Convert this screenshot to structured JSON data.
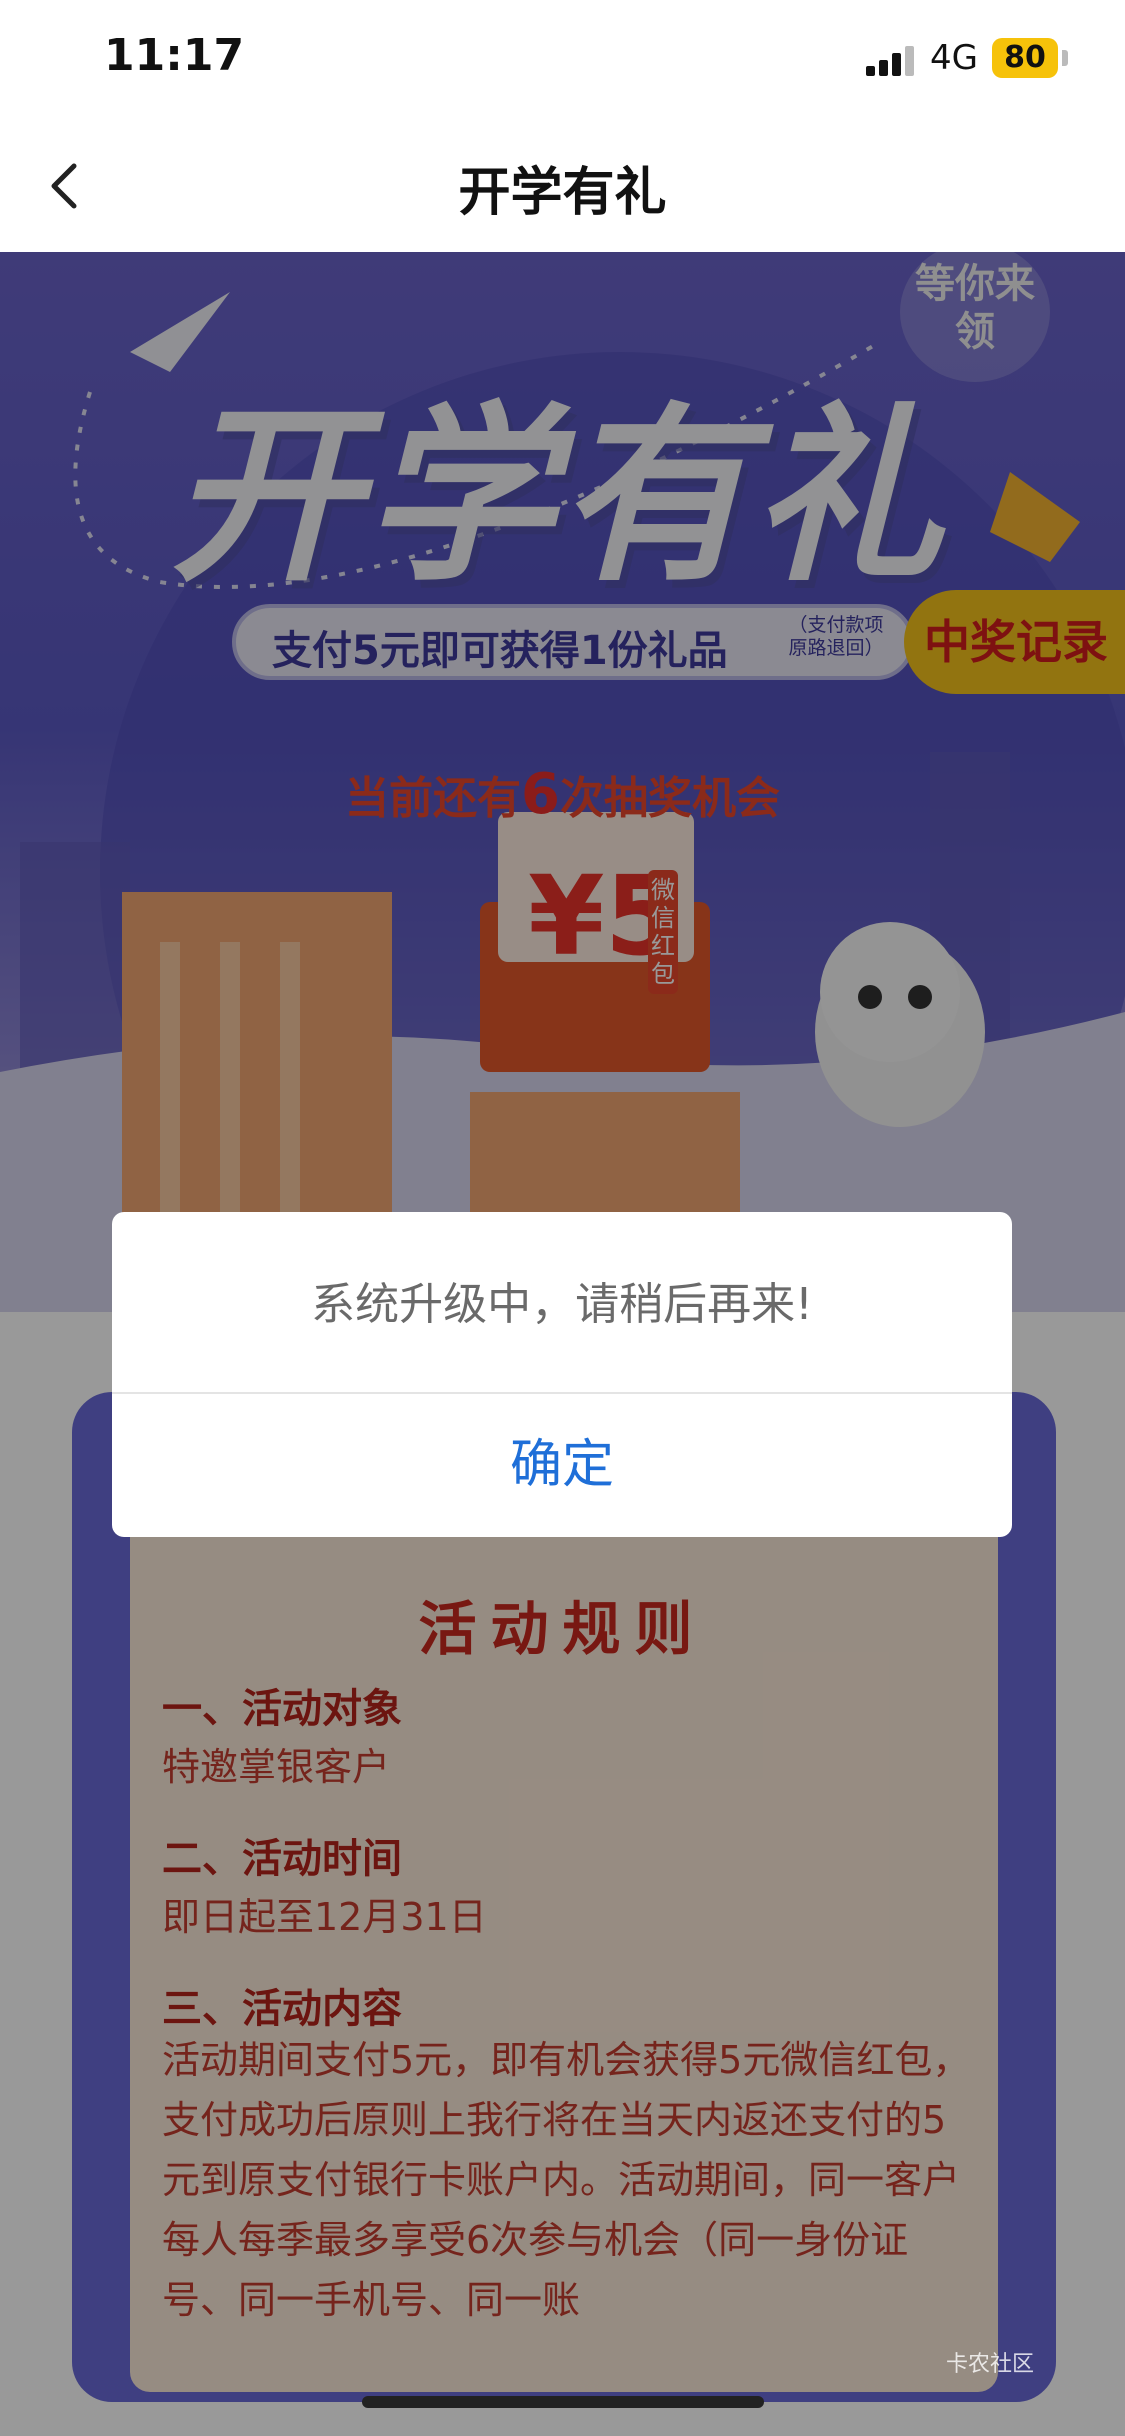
{
  "status_bar": {
    "time": "11:17",
    "network": "4G",
    "battery": "80"
  },
  "nav": {
    "title": "开学有礼"
  },
  "banner": {
    "corner_badge": "等你来领",
    "headline": "开学有礼",
    "subtitle": "支付5元即可获得1份礼品",
    "subtitle_note": "（支付款项原路退回）",
    "records_button": "中奖记录",
    "chances_prefix": "当前还有",
    "chances_count": "6",
    "chances_suffix": "次抽奖机会",
    "prize_amount": "¥5",
    "prize_tag": "微信红包"
  },
  "dialog": {
    "message": "系统升级中，请稍后再来!",
    "confirm_label": "确定"
  },
  "rules": {
    "title": "活动规则",
    "section1_title": "一、活动对象",
    "section1_text": "特邀掌银客户",
    "section2_title": "二、活动时间",
    "section2_text": "即日起至12月31日",
    "section3_title": "三、活动内容",
    "section3_text": "活动期间支付5元，即有机会获得5元微信红包，支付成功后原则上我行将在当天内返还支付的5元到原支付银行卡账户内。活动期间，同一客户每人每季最多享受6次参与机会（同一身份证号、同一手机号、同一账"
  },
  "watermark": "卡农社区"
}
